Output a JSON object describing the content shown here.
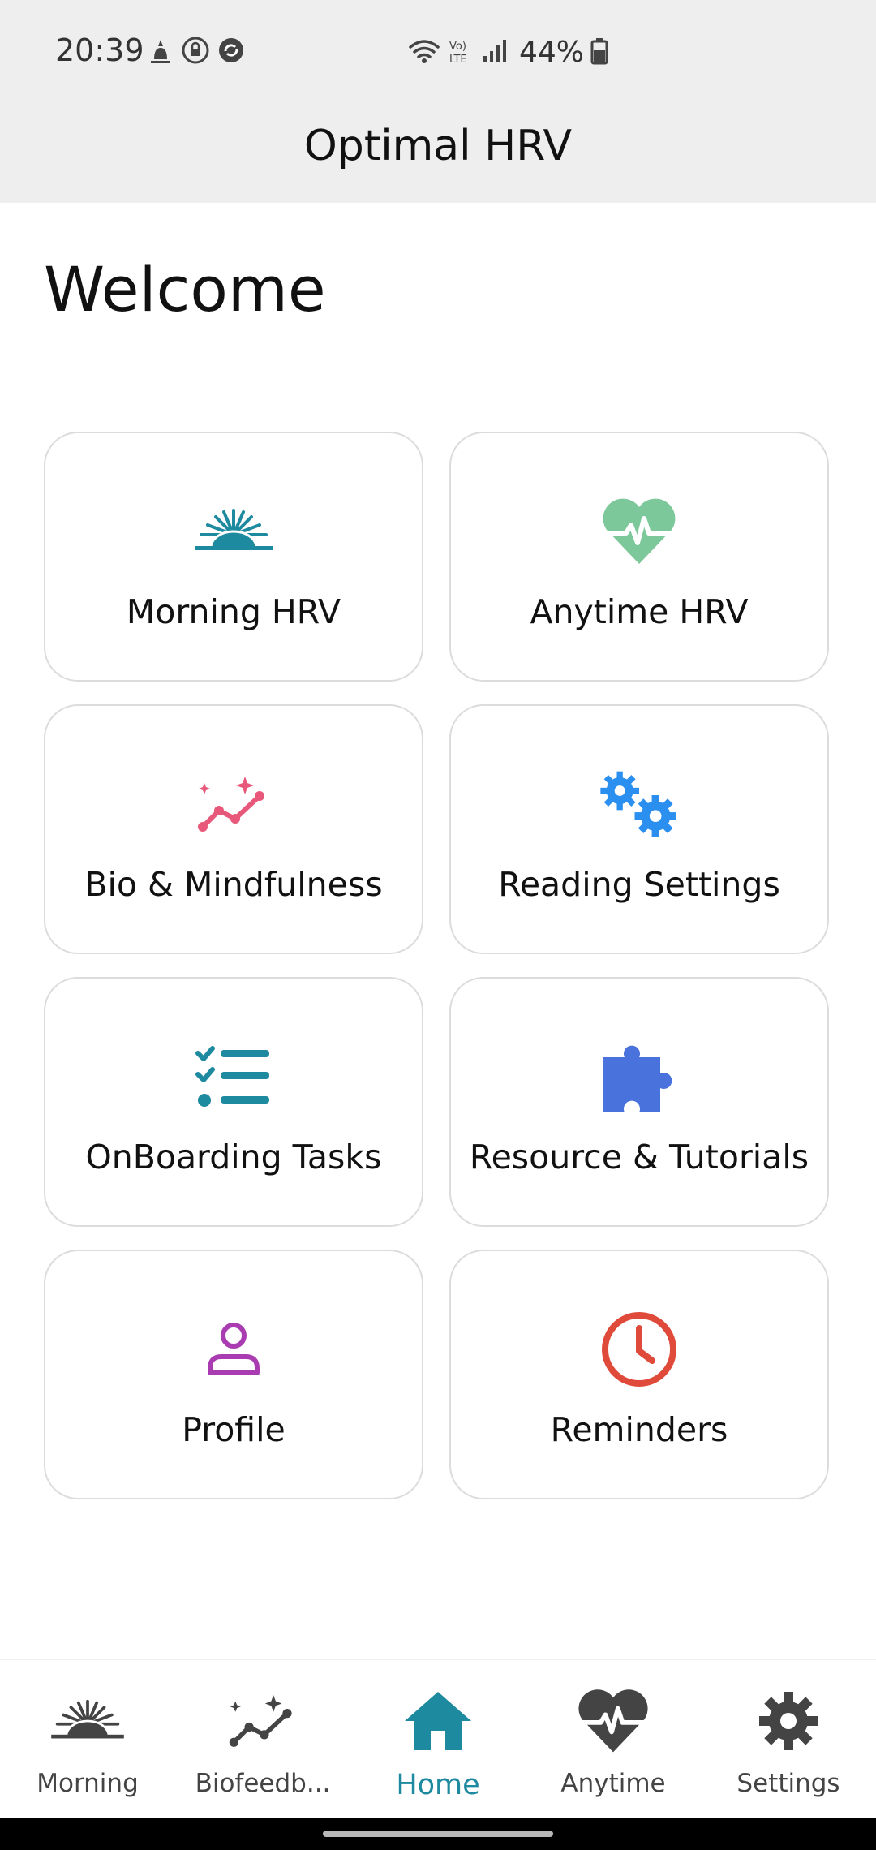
{
  "status_bar": {
    "time": "20:39",
    "battery": "44%"
  },
  "header": {
    "title": "Optimal HRV"
  },
  "main": {
    "welcome": "Welcome",
    "cards": [
      {
        "label": "Morning HRV",
        "icon": "sunrise-icon",
        "color": "#1e8aa0"
      },
      {
        "label": "Anytime HRV",
        "icon": "heart-pulse-icon",
        "color": "#7cc89a"
      },
      {
        "label": "Bio & Mindfulness",
        "icon": "sparkle-chart-icon",
        "color": "#e8587a"
      },
      {
        "label": "Reading Settings",
        "icon": "gears-icon",
        "color": "#2b8ff0"
      },
      {
        "label": "OnBoarding Tasks",
        "icon": "checklist-icon",
        "color": "#1e8aa0"
      },
      {
        "label": "Resource & Tutorials",
        "icon": "puzzle-icon",
        "color": "#4a72dc"
      },
      {
        "label": "Profile",
        "icon": "person-icon",
        "color": "#a83cb0"
      },
      {
        "label": "Reminders",
        "icon": "clock-icon",
        "color": "#e04a3a"
      }
    ]
  },
  "bottom_nav": {
    "items": [
      {
        "label": "Morning",
        "icon": "sunrise-icon"
      },
      {
        "label": "Biofeedb...",
        "icon": "sparkle-chart-icon"
      },
      {
        "label": "Home",
        "icon": "home-icon",
        "active": true
      },
      {
        "label": "Anytime",
        "icon": "heart-pulse-icon"
      },
      {
        "label": "Settings",
        "icon": "gear-icon"
      }
    ],
    "active_color": "#1e8aa0"
  }
}
